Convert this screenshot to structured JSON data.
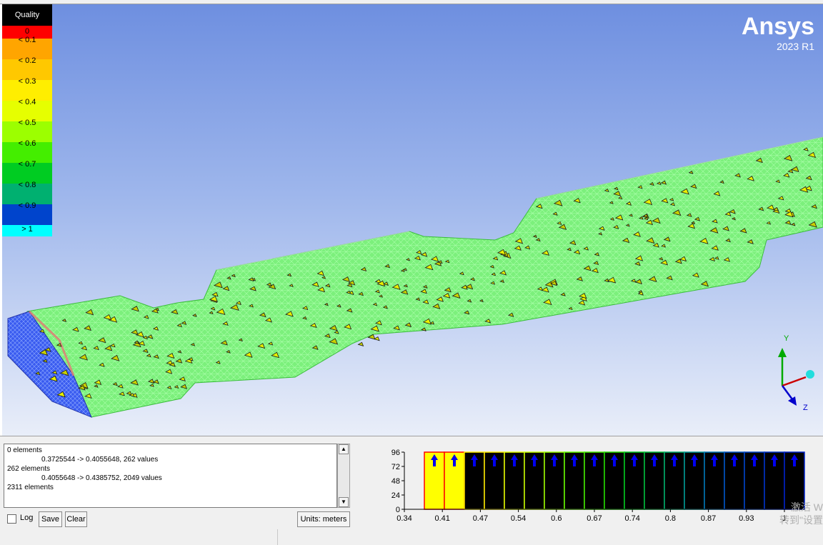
{
  "brand": {
    "name": "Ansys",
    "version": "2023 R1"
  },
  "legend": {
    "title": "Quality",
    "bands": [
      {
        "label": "0",
        "color": "#ff0000"
      },
      {
        "label": "< 0.1",
        "color": "#ffa500"
      },
      {
        "label": "< 0.2",
        "color": "#ffc800"
      },
      {
        "label": "< 0.3",
        "color": "#ffee00"
      },
      {
        "label": "< 0.4",
        "color": "#e6ff00"
      },
      {
        "label": "< 0.5",
        "color": "#9cff00"
      },
      {
        "label": "< 0.6",
        "color": "#44ee00"
      },
      {
        "label": "< 0.7",
        "color": "#00cc22"
      },
      {
        "label": "< 0.8",
        "color": "#00b070"
      },
      {
        "label": "< 0.9",
        "color": "#0044cc"
      },
      {
        "label": "> 1",
        "color": "#00ffff"
      }
    ]
  },
  "triad": {
    "y_label": "Y",
    "z_label": "Z"
  },
  "log": {
    "lines": [
      "0 elements",
      "0.3725544 -> 0.4055648, 262 values",
      "262 elements",
      "0.4055648 -> 0.4385752, 2049 values",
      "2311 elements"
    ]
  },
  "controls": {
    "log_label": "Log",
    "save_label": "Save",
    "clear_label": "Clear",
    "units_label": "Units: meters"
  },
  "watermark": {
    "line1": "激活 W",
    "line2": "转到\"设置"
  },
  "chart_data": {
    "type": "bar",
    "title": "",
    "y_ticks": [
      0,
      24,
      48,
      72,
      96
    ],
    "ylim": [
      0,
      96
    ],
    "x_ticks": [
      "0.34",
      "0.41",
      "0.47",
      "0.54",
      "0.6",
      "0.67",
      "0.74",
      "0.8",
      "0.87",
      "0.93",
      "1"
    ],
    "xlim": [
      0.34,
      1.0
    ],
    "bins": 19,
    "active_bins": [
      0,
      1
    ],
    "active_color": "#ffff00",
    "inactive_color": "#000000",
    "arrow_color": "#0000ee"
  }
}
